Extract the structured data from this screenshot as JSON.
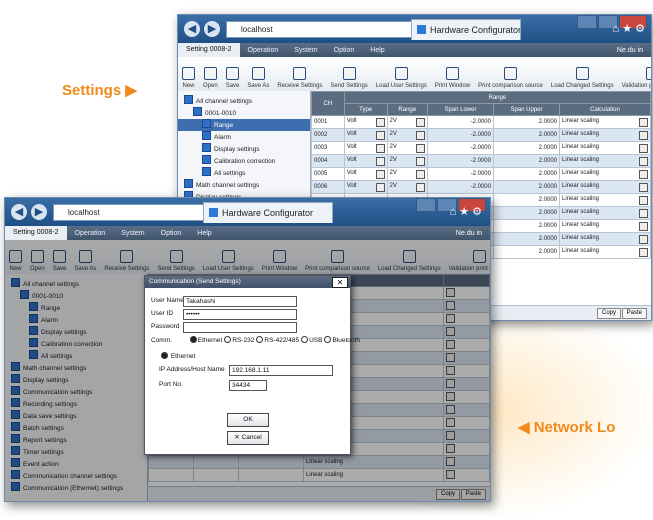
{
  "callouts": {
    "settings": "Settings ▶",
    "network": "◀ Network Lo"
  },
  "back_window": {
    "address": {
      "host": "localhost"
    },
    "tab_title": "Hardware Configurator",
    "menus": [
      {
        "label": "Setting 0008-2"
      },
      {
        "label": "Operation"
      },
      {
        "label": "System"
      },
      {
        "label": "Option"
      },
      {
        "label": "Help"
      }
    ],
    "menu_right": "Ne.du in",
    "ribbon": [
      "New",
      "Open",
      "Save",
      "Save As",
      "Receive Settings",
      "Send Settings",
      "Load User Settings",
      "Print Window",
      "Print comparison source",
      "Load Changed Settings",
      "Validation print window"
    ],
    "tree": [
      {
        "label": "All channel settings",
        "level": 0
      },
      {
        "label": "0001-0010",
        "level": 1
      },
      {
        "label": "Range",
        "level": 2,
        "selected": true
      },
      {
        "label": "Alarm",
        "level": 2
      },
      {
        "label": "Display settings",
        "level": 2
      },
      {
        "label": "Calibration correction",
        "level": 2
      },
      {
        "label": "All settings",
        "level": 2
      },
      {
        "label": "Math channel settings",
        "level": 0
      },
      {
        "label": "Display settings",
        "level": 0
      }
    ],
    "grid": {
      "group_header": "Range",
      "columns": [
        "CH",
        "Type",
        "Range",
        "Span Lower",
        "Span Upper",
        "Calculation"
      ],
      "rows": [
        {
          "ch": "0001",
          "type": "Volt",
          "range": "2V",
          "lower": "-2.0000",
          "upper": "2.0000",
          "calc": "Linear scaling"
        },
        {
          "ch": "0002",
          "type": "Volt",
          "range": "2V",
          "lower": "-2.0000",
          "upper": "2.0000",
          "calc": "Linear scaling"
        },
        {
          "ch": "0003",
          "type": "Volt",
          "range": "2V",
          "lower": "-2.0000",
          "upper": "2.0000",
          "calc": "Linear scaling"
        },
        {
          "ch": "0004",
          "type": "Volt",
          "range": "2V",
          "lower": "-2.0000",
          "upper": "2.0000",
          "calc": "Linear scaling"
        },
        {
          "ch": "0005",
          "type": "Volt",
          "range": "2V",
          "lower": "-2.0000",
          "upper": "2.0000",
          "calc": "Linear scaling"
        },
        {
          "ch": "0006",
          "type": "Volt",
          "range": "2V",
          "lower": "-2.0000",
          "upper": "2.0000",
          "calc": "Linear scaling"
        },
        {
          "ch": "",
          "type": "",
          "range": "",
          "lower": "",
          "upper": "2.0000",
          "calc": "Linear scaling"
        },
        {
          "ch": "",
          "type": "",
          "range": "",
          "lower": "",
          "upper": "2.0000",
          "calc": "Linear scaling"
        },
        {
          "ch": "",
          "type": "",
          "range": "",
          "lower": "",
          "upper": "2.0000",
          "calc": "Linear scaling"
        },
        {
          "ch": "",
          "type": "",
          "range": "",
          "lower": "",
          "upper": "2.0000",
          "calc": "Linear scaling"
        },
        {
          "ch": "",
          "type": "",
          "range": "",
          "lower": "",
          "upper": "2.0000",
          "calc": "Linear scaling"
        }
      ]
    },
    "footer": {
      "copy": "Copy",
      "paste": "Paste"
    }
  },
  "front_window": {
    "address": {
      "host": "localhost"
    },
    "tab_title": "Hardware Configurator",
    "menus": [
      {
        "label": "Setting 0008-2"
      },
      {
        "label": "Operation"
      },
      {
        "label": "System"
      },
      {
        "label": "Option"
      },
      {
        "label": "Help"
      }
    ],
    "menu_right": "Ne.du in",
    "ribbon": [
      "New",
      "Open",
      "Save",
      "Save As",
      "Receive Settings",
      "Send Settings",
      "Load User Settings",
      "Print Window",
      "Print comparison source",
      "Load Changed Settings",
      "Validation print window"
    ],
    "tree": [
      {
        "label": "All channel settings"
      },
      {
        "label": "0001-0010"
      },
      {
        "label": "Range"
      },
      {
        "label": "Alarm"
      },
      {
        "label": "Display settings"
      },
      {
        "label": "Calibration correction"
      },
      {
        "label": "All settings"
      },
      {
        "label": "Math channel settings"
      },
      {
        "label": "Display settings"
      },
      {
        "label": "Communication settings"
      },
      {
        "label": "Recording settings"
      },
      {
        "label": "Data save settings"
      },
      {
        "label": "Batch settings"
      },
      {
        "label": "Report settings"
      },
      {
        "label": "Timer settings"
      },
      {
        "label": "Event action"
      },
      {
        "label": "Communication channel settings"
      },
      {
        "label": "Communication (Ethernet) settings"
      }
    ],
    "grid_rows": [
      "Linear scaling",
      "Linear scaling",
      "Linear scaling",
      "Linear scaling",
      "Linear scaling",
      "Linear scaling",
      "Linear scaling",
      "Linear scaling",
      "Linear scaling",
      "Linear scaling",
      "Linear scaling",
      "Linear scaling",
      "Linear scaling",
      "Linear scaling",
      "Linear scaling"
    ],
    "footer": {
      "copy": "Copy",
      "paste": "Paste"
    }
  },
  "dialog": {
    "title": "Communication (Send Settings)",
    "user_name_label": "User Name",
    "user_name_value": "Takahashi",
    "user_id_label": "User ID",
    "user_id_value": "••••••",
    "password_label": "Password",
    "password_value": "",
    "comm_label": "Comm.",
    "comm_options": [
      "Ethernet",
      "RS-232",
      "RS-422/485",
      "USB",
      "Bluetooth"
    ],
    "comm_selected": "Ethernet",
    "ethernet_label": "Ethernet",
    "ip_label": "IP Address/Host Name",
    "ip_value": "192.168.1.11",
    "port_label": "Port No.",
    "port_value": "34434",
    "ok_label": "OK",
    "cancel_label": "Cancel"
  }
}
